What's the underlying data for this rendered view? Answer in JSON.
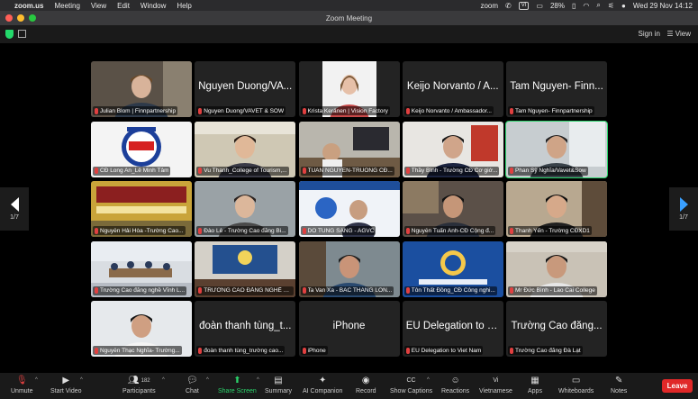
{
  "menubar": {
    "app": "zoom.us",
    "items": [
      "Meeting",
      "View",
      "Edit",
      "Window",
      "Help"
    ],
    "zoom_label": "zoom",
    "input_source": "VI",
    "battery": "28%",
    "datetime": "Wed 29 Nov  14:12"
  },
  "window": {
    "title": "Zoom Meeting"
  },
  "topbar": {
    "sign_in": "Sign in",
    "view": "View"
  },
  "gallery": {
    "tiles": [
      {
        "name": "Julian Blom | Finnpartnership",
        "video": true,
        "scene": "person-headset"
      },
      {
        "name": "Nguyen Duong/VAVET & SOW",
        "display": "Nguyen Duong/VA...",
        "video": false
      },
      {
        "name": "Krista Keränen | Vision Factory",
        "video": true,
        "scene": "woman-white"
      },
      {
        "name": "Keijo Norvanto / Ambassador...",
        "display": "Keijo Norvanto / A...",
        "video": false
      },
      {
        "name": "Tam Nguyen- Finnpartnership",
        "display": "Tam Nguyen- Finn...",
        "video": false
      },
      {
        "name": "CĐ Long An_Lê Minh Tâm",
        "video": true,
        "scene": "logo-lac",
        "logo_text": "LAC"
      },
      {
        "name": "Vu Thanh_College of Tourism,...",
        "video": true,
        "scene": "woman-office"
      },
      {
        "name": "TUAN NGUYEN-TRUONG CĐ...",
        "video": true,
        "scene": "office-desk"
      },
      {
        "name": "Thầy Bình - Trường CĐ Cơ giớ...",
        "video": true,
        "scene": "man-suit"
      },
      {
        "name": "Phan Sỹ Nghĩa/Vavet&Sow",
        "video": true,
        "scene": "man-window",
        "active": true
      },
      {
        "name": "Nguyễn Hải Hòa -Trường Cao...",
        "video": true,
        "scene": "banner-yellow"
      },
      {
        "name": "Đào  Lê - Trường Cao đẳng Bi...",
        "video": true,
        "scene": "woman-plain"
      },
      {
        "name": "DO TUNG SANG - AGVC",
        "video": true,
        "scene": "slide-blue"
      },
      {
        "name": "Nguyễn Tuấn Anh-CĐ Cộng đ...",
        "video": true,
        "scene": "man-room"
      },
      {
        "name": "Thanh Yến - Trường CĐXD1",
        "video": true,
        "scene": "woman-headset"
      },
      {
        "name": "Trường Cao đẳng nghề Vĩnh L...",
        "video": true,
        "scene": "meeting-room"
      },
      {
        "name": "TRƯỜNG CAO ĐẲNG NGHỀ VI...",
        "video": true,
        "scene": "hall-stage"
      },
      {
        "name": "Ta Van Xa - BAC THANG LON...",
        "video": true,
        "scene": "man-shelf"
      },
      {
        "name": "Tôn Thất Đồng_CĐ Công nghi...",
        "video": true,
        "scene": "logo-blue"
      },
      {
        "name": "Mr Đức Bình - Lao Cai College",
        "video": true,
        "scene": "man-glasses"
      },
      {
        "name": "Nguyễn Thạc Nghĩa- Trường...",
        "video": true,
        "scene": "man-white"
      },
      {
        "name": "đoàn thanh tùng_trường cao...",
        "display": "đoàn thanh tùng_t...",
        "video": false
      },
      {
        "name": "iPhone",
        "display": "iPhone",
        "video": false
      },
      {
        "name": "EU Delegation to Viet Nam",
        "display": "EU Delegation to V...",
        "video": false
      },
      {
        "name": "Trường Cao đẳng Đà Lạt",
        "display": "Trường Cao đẳng...",
        "video": false
      }
    ]
  },
  "pager": {
    "left": "1/7",
    "right": "1/7"
  },
  "toolbar": {
    "unmute": "Unmute",
    "start_video": "Start Video",
    "participants": "Participants",
    "participant_count": "182",
    "chat": "Chat",
    "share_screen": "Share Screen",
    "summary": "Summary",
    "ai_companion": "AI Companion",
    "record": "Record",
    "show_captions": "Show Captions",
    "reactions": "Reactions",
    "language": "Vietnamese",
    "apps": "Apps",
    "whiteboards": "Whiteboards",
    "notes": "Notes",
    "leave": "Leave"
  },
  "colors": {
    "accent_green": "#2bd36b",
    "leave_red": "#e02828",
    "pager_blue": "#3aa0ff"
  }
}
